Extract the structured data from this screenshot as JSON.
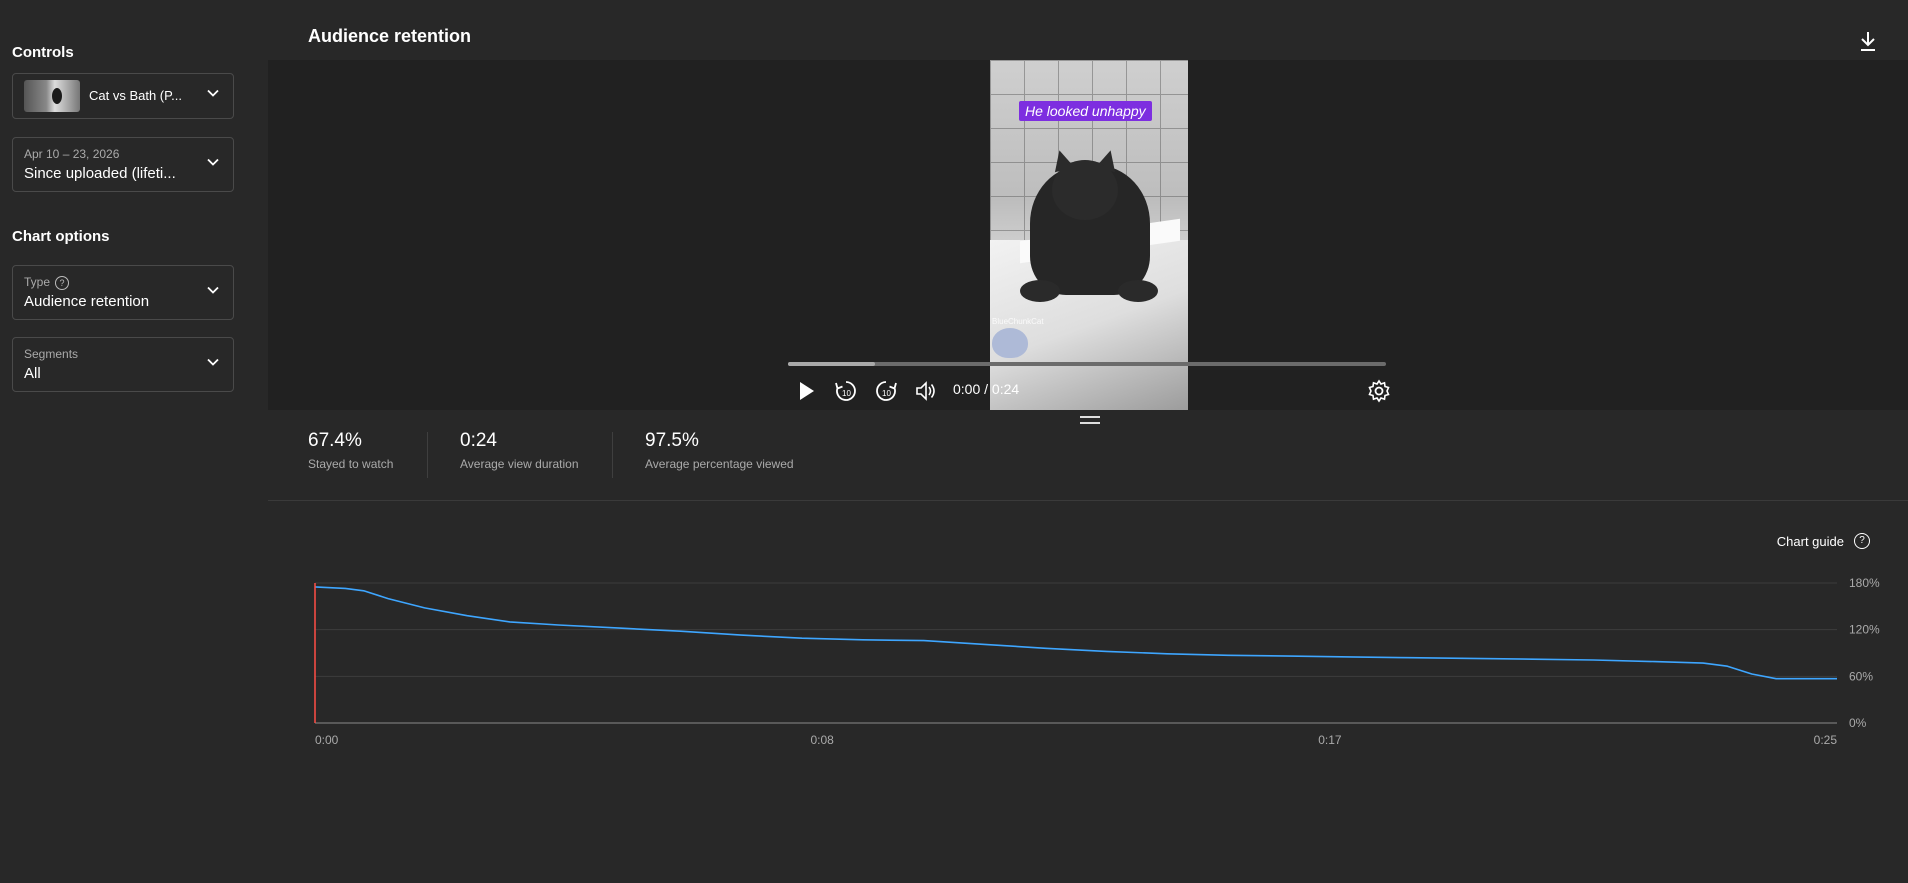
{
  "sidebar": {
    "controls_title": "Controls",
    "video_select": {
      "value": "Cat vs Bath (P..."
    },
    "date_select": {
      "range": "Apr 10 – 23, 2026",
      "value": "Since uploaded (lifeti..."
    },
    "chart_options_title": "Chart options",
    "type_select": {
      "label": "Type",
      "value": "Audience retention"
    },
    "segments_select": {
      "label": "Segments",
      "value": "All"
    }
  },
  "main": {
    "title": "Audience retention",
    "video": {
      "caption": "He looked unhappy",
      "watermark": "BlueChunkCat",
      "time": "0:00 / 0:24",
      "progress_buffered_fraction": 0.146
    },
    "stats": [
      {
        "value": "67.4%",
        "label": "Stayed to watch"
      },
      {
        "value": "0:24",
        "label": "Average view duration"
      },
      {
        "value": "97.5%",
        "label": "Average percentage viewed"
      }
    ],
    "chart_guide_label": "Chart guide"
  },
  "icons": {
    "download": "download-icon",
    "play": "play-icon",
    "rewind": "replay-10-icon",
    "forward": "forward-10-icon",
    "volume": "volume-icon",
    "settings": "gear-icon"
  },
  "colors": {
    "line": "#3ea6ff",
    "playhead": "#ff4e45",
    "grid": "#3c3c3c"
  },
  "chart_data": {
    "type": "line",
    "title": "",
    "xlabel": "",
    "ylabel": "",
    "x_ticks": [
      "0:00",
      "0:08",
      "0:17",
      "0:25"
    ],
    "y_ticks": [
      "180%",
      "120%",
      "60%",
      "0%"
    ],
    "xlim": [
      0,
      25
    ],
    "ylim": [
      0,
      180
    ],
    "grid": true,
    "series": [
      {
        "x": [
          0,
          0.5,
          0.8,
          1.2,
          1.8,
          2.5,
          3.2,
          4.0,
          5,
          6,
          7,
          8,
          9,
          10,
          11,
          12,
          13,
          14,
          15,
          16,
          17,
          18,
          19,
          20,
          21,
          22,
          22.8,
          23.2,
          23.6,
          24.0,
          24.5,
          25
        ],
        "values": [
          175,
          173,
          170,
          160,
          148,
          138,
          130,
          126,
          122,
          118,
          113,
          109,
          107,
          106,
          101,
          96,
          92,
          89,
          87,
          86,
          85,
          84,
          83,
          82,
          81,
          79,
          77,
          73,
          63,
          57,
          57,
          57
        ]
      }
    ]
  }
}
